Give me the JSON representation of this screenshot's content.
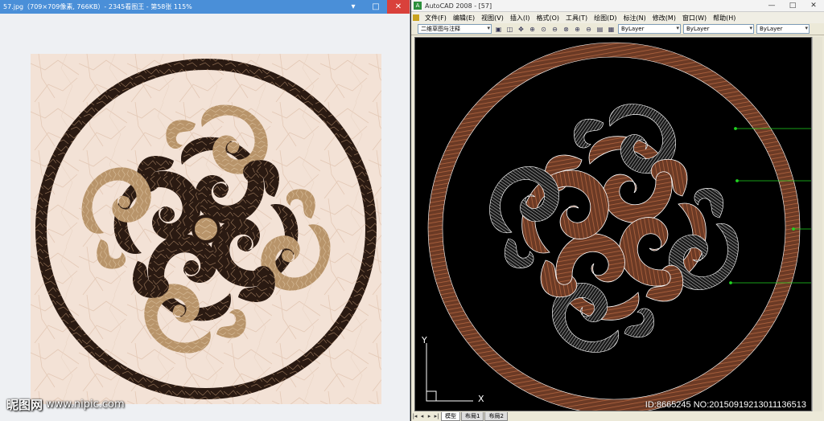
{
  "viewer": {
    "title": "57.jpg（709×709像素, 766KB）- 2345看图王 - 第58张 115%",
    "minimize": "▾",
    "maximize": "□",
    "close": "✕"
  },
  "cad": {
    "title": "AutoCAD 2008 - [57]",
    "app_icon": "A",
    "minimize": "—",
    "maximize": "□",
    "close": "✕",
    "menu": [
      "文件(F)",
      "编辑(E)",
      "视图(V)",
      "插入(I)",
      "格式(O)",
      "工具(T)",
      "绘图(D)",
      "标注(N)",
      "修改(M)",
      "窗口(W)",
      "帮助(H)"
    ],
    "workspace": "二维草图与注释",
    "color_combo": "ByLayer",
    "linetype_combo": "ByLayer",
    "lineweight_combo": "ByLayer",
    "ucs": {
      "y": "Y",
      "x": "X"
    },
    "tabs": [
      "模型",
      "布局1",
      "布局2"
    ],
    "tab_nav": [
      "|◂",
      "◂",
      "▸",
      "▸|"
    ]
  },
  "watermark": {
    "logo": "昵图网",
    "url": "www.nipic.com"
  },
  "image_id": "ID:8665245 NO:20150919213011136513",
  "colors": {
    "marble_light": "#f3e2d6",
    "marble_dark": "#2a1a12",
    "gold_marble": "#b8946a",
    "cad_brown": "#8a4a30",
    "cad_hatch": "#d9d9d9",
    "cad_line": "#ffffff",
    "leader_green": "#21d421"
  }
}
